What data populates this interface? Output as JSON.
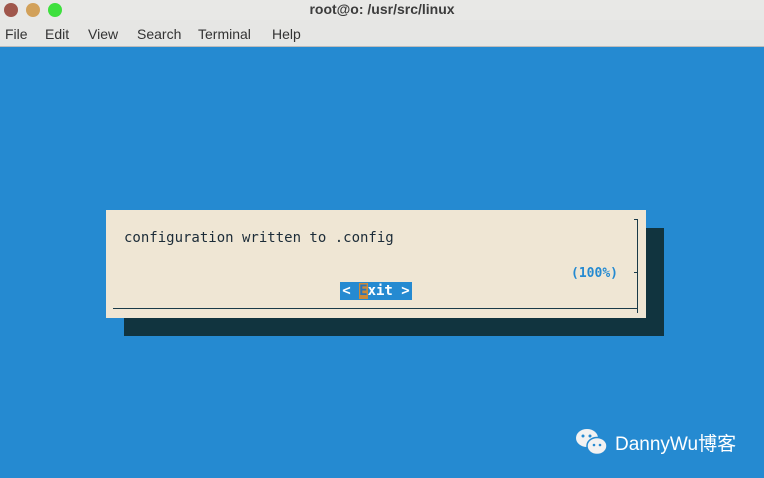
{
  "window": {
    "title": "root@o: /usr/src/linux"
  },
  "menu": [
    "File",
    "Edit",
    "View",
    "Search",
    "Terminal",
    "Help"
  ],
  "dialog": {
    "message": "configuration written to .config",
    "progress": "(100%)",
    "exit_left": "< ",
    "exit_hot": "E",
    "exit_rest": "xit >"
  },
  "watermark": {
    "text": "DannyWu博客",
    "icon": "wechat-icon"
  },
  "colors": {
    "terminal_bg": "#258ad1",
    "dialog_bg": "#efe6d4",
    "shadow": "#11343f"
  }
}
